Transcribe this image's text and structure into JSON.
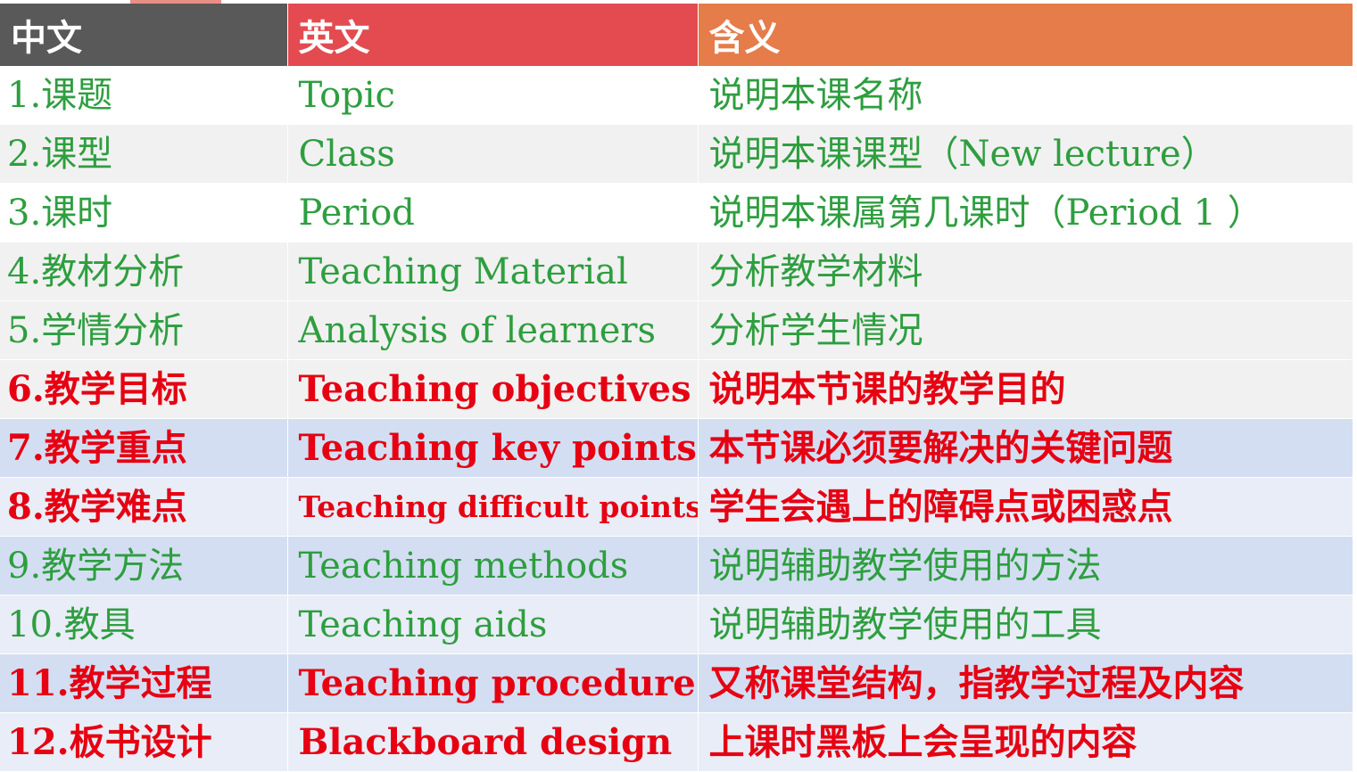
{
  "header": {
    "col_chinese": "中文",
    "col_english": "英文",
    "col_meaning": "含义"
  },
  "colors": {
    "header_chinese_bg": "#595959",
    "header_english_bg": "#e34b51",
    "header_meaning_bg": "#e57c49",
    "green_text": "#2e9e3f",
    "red_text": "#e60012"
  },
  "rows": [
    {
      "chinese": "1.课题",
      "english": "Topic",
      "meaning": "说明本课名称"
    },
    {
      "chinese": "2.课型",
      "english": "Class",
      "meaning": "说明本课课型（New lecture）"
    },
    {
      "chinese": "3.课时",
      "english": "Period",
      "meaning": "说明本课属第几课时（Period 1 ）"
    },
    {
      "chinese": "4.教材分析",
      "english": "Teaching Material",
      "meaning": "分析教学材料"
    },
    {
      "chinese": "5.学情分析",
      "english": "Analysis of learners",
      "meaning": "分析学生情况"
    },
    {
      "chinese": "6.教学目标",
      "english": "Teaching objectives",
      "meaning": "说明本节课的教学目的"
    },
    {
      "chinese": "7.教学重点",
      "english": "Teaching key points",
      "meaning": "本节课必须要解决的关键问题"
    },
    {
      "chinese": "8.教学难点",
      "english": "Teaching difficult points",
      "meaning": "学生会遇上的障碍点或困惑点"
    },
    {
      "chinese": "9.教学方法",
      "english": "Teaching methods",
      "meaning": "说明辅助教学使用的方法"
    },
    {
      "chinese": "10.教具",
      "english": "Teaching aids",
      "meaning": "说明辅助教学使用的工具"
    },
    {
      "chinese": "11.教学过程",
      "english": "Teaching procedure",
      "meaning": "又称课堂结构，指教学过程及内容"
    },
    {
      "chinese": "12.板书设计",
      "english": "Blackboard design",
      "meaning": "上课时黑板上会呈现的内容"
    }
  ]
}
